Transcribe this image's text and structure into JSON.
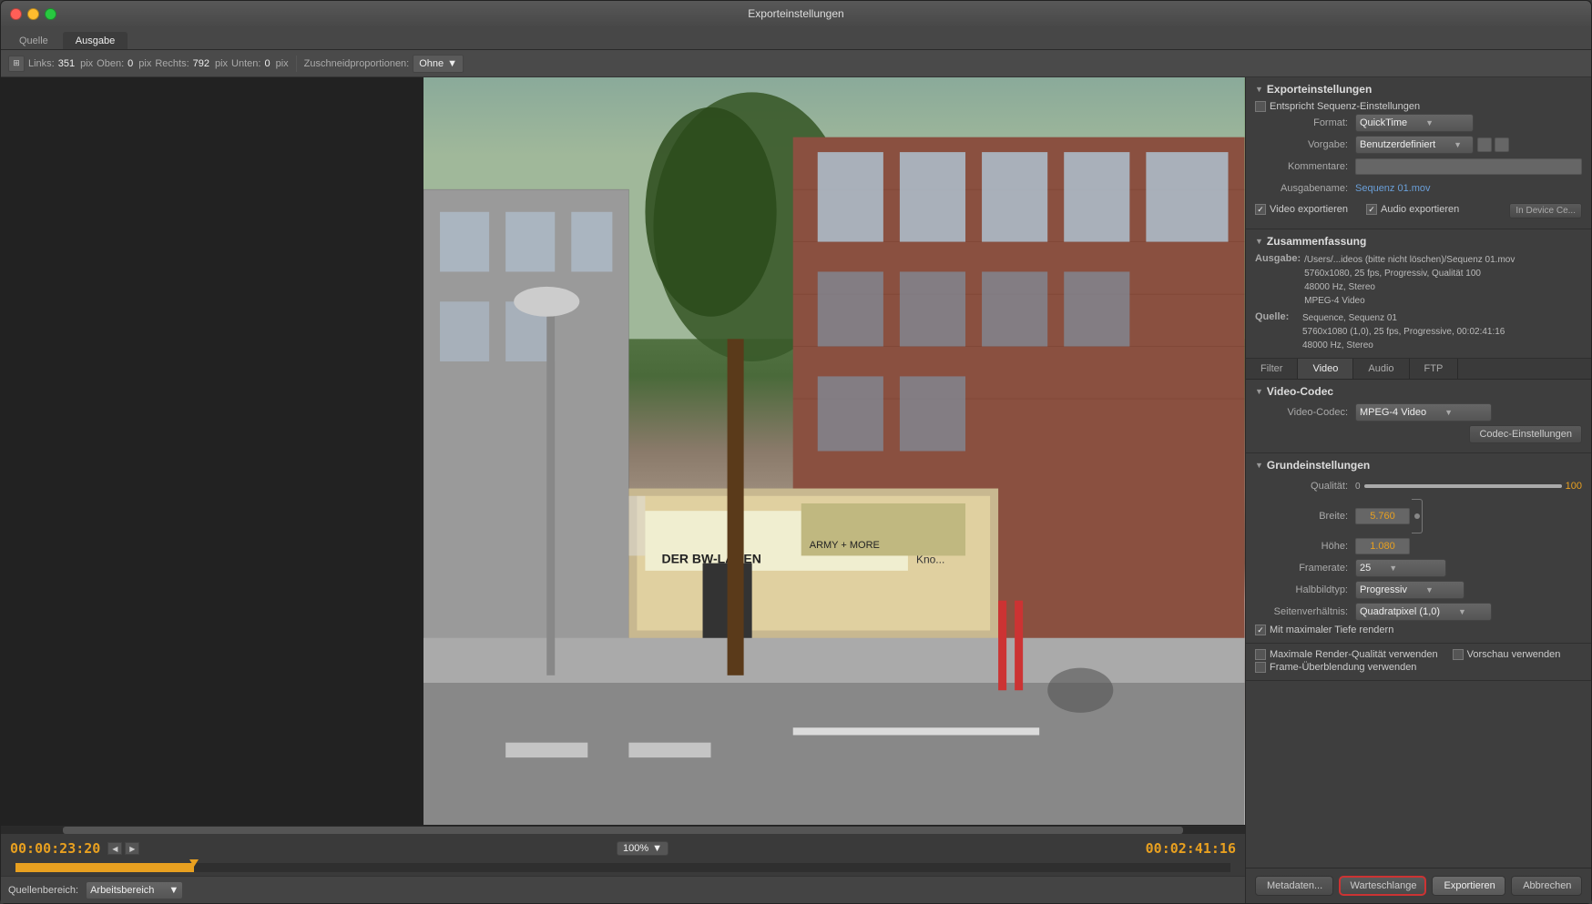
{
  "window": {
    "title": "Exporteinstellungen"
  },
  "tabs": {
    "quelle": "Quelle",
    "ausgabe": "Ausgabe"
  },
  "toolbar": {
    "links_label": "Links:",
    "links_value": "351",
    "pix1": "pix",
    "oben_label": "Oben:",
    "oben_value": "0",
    "pix2": "pix",
    "rechts_label": "Rechts:",
    "rechts_value": "792",
    "pix3": "pix",
    "unten_label": "Unten:",
    "unten_value": "0",
    "pix4": "pix",
    "schneideprop_label": "Zuschneidproportionen:",
    "schneideprop_value": "Ohne",
    "dropdown_arrow": "▼"
  },
  "timecodes": {
    "current": "00:00:23:20",
    "total": "00:02:41:16"
  },
  "zoom": {
    "value": "100%",
    "arrow": "▼"
  },
  "bottom_bar": {
    "quellenbereich_label": "Quellenbereich:",
    "quellenbereich_value": "Arbeitsbereich",
    "dropdown_arrow": "▼"
  },
  "right_panel": {
    "export_settings_header": "Exporteinstellungen",
    "entspricht_label": "Entspricht Sequenz-Einstellungen",
    "format_label": "Format:",
    "format_value": "QuickTime",
    "vorgabe_label": "Vorgabe:",
    "vorgabe_value": "Benutzerdefiniert",
    "kommentare_label": "Kommentare:",
    "ausgabename_label": "Ausgabename:",
    "ausgabename_value": "Sequenz 01.mov",
    "video_exportieren": "Video exportieren",
    "audio_exportieren": "Audio exportieren",
    "in_device": "In Device Ce...",
    "zusammenfassung_header": "Zusammenfassung",
    "ausgabe_label": "Ausgabe:",
    "ausgabe_path": "/Users/...ideos (bitte nicht löschen)/Sequenz 01.mov",
    "ausgabe_line2": "5760x1080, 25 fps, Progressiv, Qualität 100",
    "ausgabe_line3": "48000 Hz, Stereo",
    "ausgabe_line4": "MPEG-4 Video",
    "quelle_label": "Quelle:",
    "quelle_value": "Sequence, Sequenz 01",
    "quelle_line2": "5760x1080 (1,0), 25 fps, Progressive, 00:02:41:16",
    "quelle_line3": "48000 Hz, Stereo",
    "panel_tabs": {
      "filter": "Filter",
      "video": "Video",
      "audio": "Audio",
      "ftp": "FTP"
    },
    "video_codec_header": "Video-Codec",
    "video_codec_label": "Video-Codec:",
    "video_codec_value": "MPEG-4 Video",
    "codec_einstellungen": "Codec-Einstellungen",
    "grundeinstellungen_header": "Grundeinstellungen",
    "qualitaet_label": "Qualität:",
    "qualitaet_value": "100",
    "qualitaet_slider_left": "0",
    "qualitaet_slider_right": "100",
    "breite_label": "Breite:",
    "breite_value": "5.760",
    "hoehe_label": "Höhe:",
    "hoehe_value": "1.080",
    "framerate_label": "Framerate:",
    "framerate_value": "25",
    "halbbildtyp_label": "Halbbildtyp:",
    "halbbildtyp_value": "Progressiv",
    "seitenverhaeltnis_label": "Seitenverhältnis:",
    "seitenverhaeltnis_value": "Quadratpixel (1,0)",
    "max_tiefe": "Mit maximaler Tiefe rendern",
    "max_render": "Maximale Render-Qualität verwenden",
    "vorschau": "Vorschau verwenden",
    "frame_ueberblendung": "Frame-Überblendung verwenden"
  },
  "action_buttons": {
    "metadaten": "Metadaten...",
    "warteschlange": "Warteschlange",
    "exportieren": "Exportieren",
    "abbrechen": "Abbrechen"
  }
}
